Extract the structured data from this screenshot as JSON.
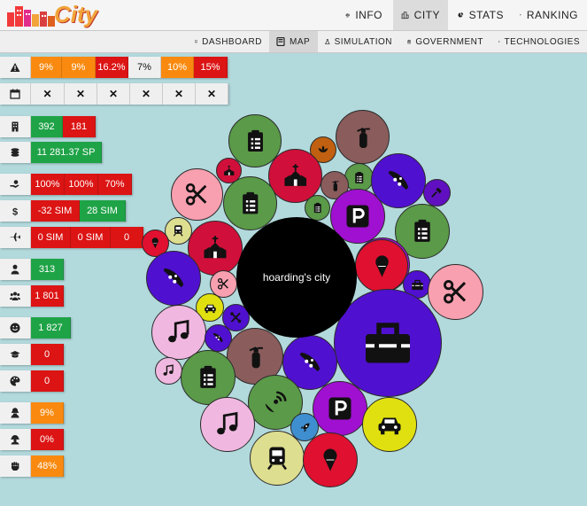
{
  "app": {
    "name": "City"
  },
  "colors": {
    "orange": "#f98a0f",
    "red": "#dc1414",
    "green": "#1fa347",
    "background": "#b2d9dc"
  },
  "topnav": [
    {
      "name": "INFO",
      "icon": "balance-scale-icon"
    },
    {
      "name": "CITY",
      "icon": "city-icon",
      "active": true
    },
    {
      "name": "STATS",
      "icon": "pie-chart-icon"
    },
    {
      "name": "RANKING",
      "icon": "trophy-icon"
    }
  ],
  "subnav": [
    {
      "name": "DASHBOARD",
      "icon": "monitor-icon"
    },
    {
      "name": "MAP",
      "icon": "map-icon",
      "active": true
    },
    {
      "name": "SIMULATION",
      "icon": "flask-icon"
    },
    {
      "name": "GOVERNMENT",
      "icon": "parliament-icon"
    },
    {
      "name": "TECHNOLOGIES",
      "icon": "chip-icon"
    }
  ],
  "stats": [
    {
      "icon": "warning-icon",
      "cells": [
        {
          "v": "9%",
          "c": "orange"
        },
        {
          "v": "9%",
          "c": "orange"
        },
        {
          "v": "16.2%",
          "c": "red"
        },
        {
          "v": "7%",
          "c": "white"
        },
        {
          "v": "10%",
          "c": "orange"
        },
        {
          "v": "15%",
          "c": "red"
        }
      ]
    },
    {
      "icon": "calendar-icon",
      "cells": [
        {
          "v": "✕",
          "c": "x"
        },
        {
          "v": "✕",
          "c": "x"
        },
        {
          "v": "✕",
          "c": "x"
        },
        {
          "v": "✕",
          "c": "x"
        },
        {
          "v": "✕",
          "c": "x"
        },
        {
          "v": "✕",
          "c": "x"
        }
      ]
    },
    {
      "icon": "building-icon",
      "cells": [
        {
          "v": "392",
          "c": "green"
        },
        {
          "v": "181",
          "c": "red"
        }
      ]
    },
    {
      "icon": "coins-icon",
      "cells": [
        {
          "v": "11 281.37 SP",
          "c": "green"
        }
      ]
    },
    {
      "icon": "hand-money-icon",
      "cells": [
        {
          "v": "100%",
          "c": "red"
        },
        {
          "v": "100%",
          "c": "red"
        },
        {
          "v": "70%",
          "c": "red"
        }
      ]
    },
    {
      "icon": "dollar-icon",
      "cells": [
        {
          "v": "-32 SIM",
          "c": "red"
        },
        {
          "v": "28 SIM",
          "c": "green"
        }
      ]
    },
    {
      "icon": "plane-icon",
      "cells": [
        {
          "v": "0 SIM",
          "c": "red"
        },
        {
          "v": "0 SIM",
          "c": "red"
        },
        {
          "v": "0",
          "c": "red"
        }
      ]
    },
    {
      "icon": "person-icon",
      "cells": [
        {
          "v": "313",
          "c": "green"
        }
      ]
    },
    {
      "icon": "people-icon",
      "cells": [
        {
          "v": "1 801",
          "c": "red"
        }
      ]
    },
    {
      "icon": "smile-icon",
      "cells": [
        {
          "v": "1 827",
          "c": "green"
        }
      ]
    },
    {
      "icon": "graduation-cap-icon",
      "cells": [
        {
          "v": "0",
          "c": "red"
        }
      ]
    },
    {
      "icon": "palette-icon",
      "cells": [
        {
          "v": "0",
          "c": "red"
        }
      ]
    },
    {
      "icon": "thief-icon",
      "cells": [
        {
          "v": "9%",
          "c": "orange"
        }
      ]
    },
    {
      "icon": "worker-icon",
      "cells": [
        {
          "v": "0%",
          "c": "red"
        }
      ]
    },
    {
      "icon": "fist-icon",
      "cells": [
        {
          "v": "48%",
          "c": "orange"
        }
      ]
    }
  ],
  "map": {
    "city_name": "hoarding's city",
    "bubbles": [
      {
        "type": "clipboard",
        "color": "#5a9a48"
      },
      {
        "type": "fire-extinguisher",
        "color": "#8a5c5c"
      },
      {
        "type": "lotus",
        "color": "#c06010"
      },
      {
        "type": "church",
        "color": "#d0103a"
      },
      {
        "type": "church",
        "color": "#d0103a"
      },
      {
        "type": "clipboard",
        "color": "#5a9a48"
      },
      {
        "type": "pizza",
        "color": "#5010d0"
      },
      {
        "type": "scissors",
        "color": "#f8a0b0"
      },
      {
        "type": "fire-extinguisher",
        "color": "#8a5c5c"
      },
      {
        "type": "clipboard",
        "color": "#5a9a48"
      },
      {
        "type": "hammer",
        "color": "#6010c0"
      },
      {
        "type": "clipboard",
        "color": "#5a9a48"
      },
      {
        "type": "parking",
        "color": "#a010d0"
      },
      {
        "type": "clipboard",
        "color": "#5a9a48"
      },
      {
        "type": "parking",
        "color": "#a010d0"
      },
      {
        "type": "train",
        "color": "#dede90"
      },
      {
        "type": "ice-cream",
        "color": "#e01030"
      },
      {
        "type": "church",
        "color": "#d0103a"
      },
      {
        "type": "ice-cream",
        "color": "#e01030"
      },
      {
        "type": "pizza",
        "color": "#5010d0"
      },
      {
        "type": "toolbox",
        "color": "#5010d0"
      },
      {
        "type": "scissors",
        "color": "#f8a0b0"
      },
      {
        "type": "scissors",
        "color": "#f8a0b0"
      },
      {
        "type": "car",
        "color": "#e0e010"
      },
      {
        "type": "tools",
        "color": "#5010d0"
      },
      {
        "type": "music",
        "color": "#f0b8e0"
      },
      {
        "type": "toolbox",
        "color": "#5010d0"
      },
      {
        "type": "pizza",
        "color": "#5010d0"
      },
      {
        "type": "fire-extinguisher",
        "color": "#8a5c5c"
      },
      {
        "type": "music",
        "color": "#f0b8e0"
      },
      {
        "type": "pizza",
        "color": "#5010d0"
      },
      {
        "type": "clipboard",
        "color": "#5a9a48"
      },
      {
        "type": "satellite",
        "color": "#5a9a48"
      },
      {
        "type": "parking",
        "color": "#a010d0"
      },
      {
        "type": "car",
        "color": "#e0e010"
      },
      {
        "type": "music",
        "color": "#f0b8e0"
      },
      {
        "type": "rocket",
        "color": "#3f8fd0"
      },
      {
        "type": "train",
        "color": "#dede90"
      },
      {
        "type": "ice-cream",
        "color": "#e01030"
      }
    ]
  }
}
